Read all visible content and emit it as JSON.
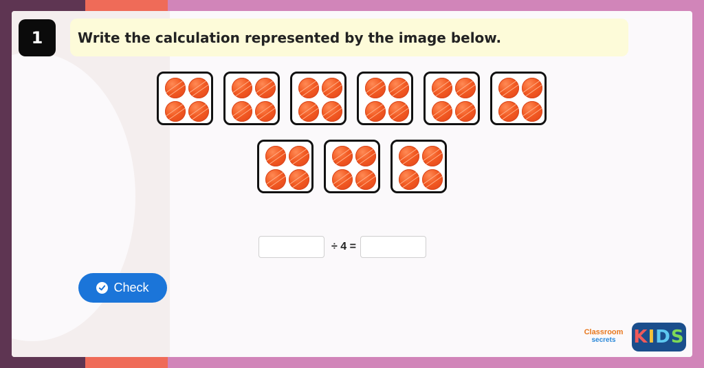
{
  "question": {
    "number": "1",
    "prompt": "Write the calculation represented by the image below."
  },
  "image": {
    "groups": 9,
    "items_per_group": 4,
    "item_icon": "orange-ball-icon"
  },
  "calculation": {
    "dividend_value": "",
    "operator_text": "÷ 4 =",
    "quotient_value": ""
  },
  "check_button": {
    "label": "Check",
    "icon": "check-circle-icon",
    "color": "#1b75d9"
  },
  "logos": {
    "classroom": "Classroom",
    "secrets": "secrets",
    "kids": [
      "K",
      "I",
      "D",
      "S"
    ]
  }
}
